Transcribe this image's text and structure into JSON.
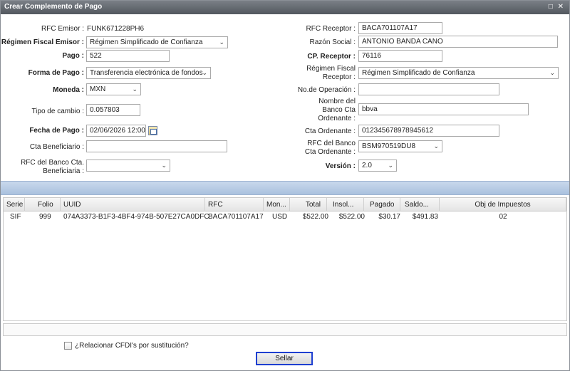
{
  "window": {
    "title": "Crear Complemento de Pago",
    "controls": "□ ✕"
  },
  "emisor": {
    "rfc_label": "RFC Emisor :",
    "rfc_value": "FUNK671228PH6",
    "regimen_label": "Régimen Fiscal Emisor :",
    "regimen_value": "Régimen Simplificado de Confianza",
    "pago_label": "Pago :",
    "pago_value": "522",
    "forma_label": "Forma de Pago :",
    "forma_value": "Transferencia electrónica de fondos",
    "moneda_label": "Moneda :",
    "moneda_value": "MXN",
    "tipo_cambio_label": "Tipo de cambio :",
    "tipo_cambio_value": "0.057803",
    "fecha_label": "Fecha de Pago :",
    "fecha_value": "02/06/2026 12:00",
    "cta_benef_label": "Cta Beneficiario :",
    "cta_benef_value": "",
    "rfc_banco_benef_label_1": "RFC del Banco Cta.",
    "rfc_banco_benef_label_2": "Beneficiaria :",
    "rfc_banco_benef_value": ""
  },
  "receptor": {
    "rfc_label": "RFC Receptor :",
    "rfc_value": "BACA701107A17",
    "razon_label": "Razón Social :",
    "razon_value": "ANTONIO BANDA CANO",
    "cp_label": "CP. Receptor :",
    "cp_value": "76116",
    "regimen_label_1": "Régimen Fiscal",
    "regimen_label_2": "Receptor :",
    "regimen_value": "Régimen Simplificado de Confianza",
    "no_operacion_label": "No.de Operación :",
    "no_operacion_value": "",
    "nombre_banco_label_1": "Nombre del",
    "nombre_banco_label_2": "Banco Cta",
    "nombre_banco_label_3": "Ordenante :",
    "nombre_banco_value": "bbva",
    "cta_ord_label": "Cta Ordenante :",
    "cta_ord_value": "012345678978945612",
    "rfc_banco_ord_label_1": "RFC del Banco",
    "rfc_banco_ord_label_2": "Cta Ordenante :",
    "rfc_banco_ord_value": "BSM970519DU8",
    "version_label": "Versión :",
    "version_value": "2.0"
  },
  "table": {
    "headers": [
      "Serie",
      "Folio",
      "UUID",
      "RFC",
      "Mon...",
      "Total",
      "Insol...",
      "Pagado",
      "Saldo...",
      "Obj de Impuestos"
    ],
    "rows": [
      [
        "SIF",
        "999",
        "074A3373-B1F3-4BF4-974B-507E27CA0DFC",
        "BACA701107A17",
        "USD",
        "$522.00",
        "$522.00",
        "$30.17",
        "$491.83",
        "02"
      ]
    ]
  },
  "options": {
    "relacionar_label": "¿Relacionar CFDI's por sustitución?"
  },
  "actions": {
    "sellar_label": "Sellar"
  }
}
